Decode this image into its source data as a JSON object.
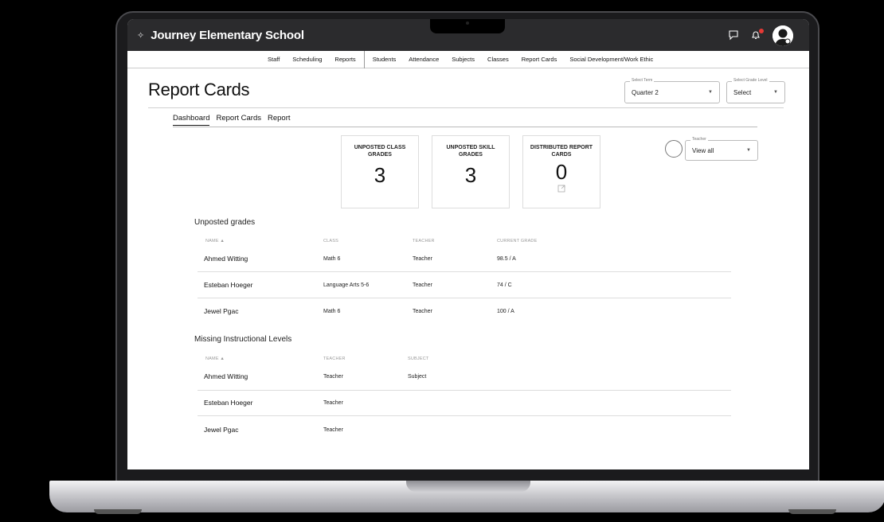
{
  "app": {
    "school_name": "Journey Elementary School"
  },
  "nav": {
    "items": [
      "Staff",
      "Scheduling",
      "Reports",
      "Students",
      "Attendance",
      "Subjects",
      "Classes",
      "Report Cards",
      "Social Development/Work Ethic"
    ]
  },
  "page": {
    "title": "Report Cards",
    "term_select": {
      "legend": "Select Term",
      "value": "Quarter 2"
    },
    "grade_select": {
      "legend": "Select Grade Level",
      "value": "Select"
    }
  },
  "tabs": [
    "Dashboard",
    "Report Cards",
    "Report"
  ],
  "cards": [
    {
      "label": "UNPOSTED CLASS GRADES",
      "value": "3"
    },
    {
      "label": "UNPOSTED SKILL GRADES",
      "value": "3"
    },
    {
      "label": "DISTRIBUTED REPORT CARDS",
      "value": "0"
    }
  ],
  "teacher_filter": {
    "legend": "Teacher",
    "value": "View all"
  },
  "unposted": {
    "title": "Unposted grades",
    "headers": [
      "NAME ▲",
      "CLASS",
      "TEACHER",
      "CURRENT GRADE"
    ],
    "rows": [
      {
        "name": "Ahmed Witting",
        "class": "Math 6",
        "teacher": "Teacher",
        "grade": "98.5 / A"
      },
      {
        "name": "Esteban Hoeger",
        "class": "Language Arts 5-6",
        "teacher": "Teacher",
        "grade": "74 / C"
      },
      {
        "name": "Jewel Pgac",
        "class": "Math 6",
        "teacher": "Teacher",
        "grade": "100 / A"
      }
    ]
  },
  "missing_levels": {
    "title": "Missing Instructional Levels",
    "headers": [
      "NAME ▲",
      "TEACHER",
      "SUBJECT"
    ],
    "rows": [
      {
        "name": "Ahmed Witting",
        "teacher": "Teacher",
        "subject": "Subject"
      },
      {
        "name": "Esteban Hoeger",
        "teacher": "Teacher",
        "subject": ""
      },
      {
        "name": "Jewel Pgac",
        "teacher": "Teacher",
        "subject": ""
      }
    ]
  },
  "colors": {
    "topbar": "#2b2b2d",
    "notification": "#e53935"
  },
  "icons": [
    "chat-icon",
    "bell-icon",
    "avatar",
    "external-link-icon",
    "sort-up-icon"
  ]
}
